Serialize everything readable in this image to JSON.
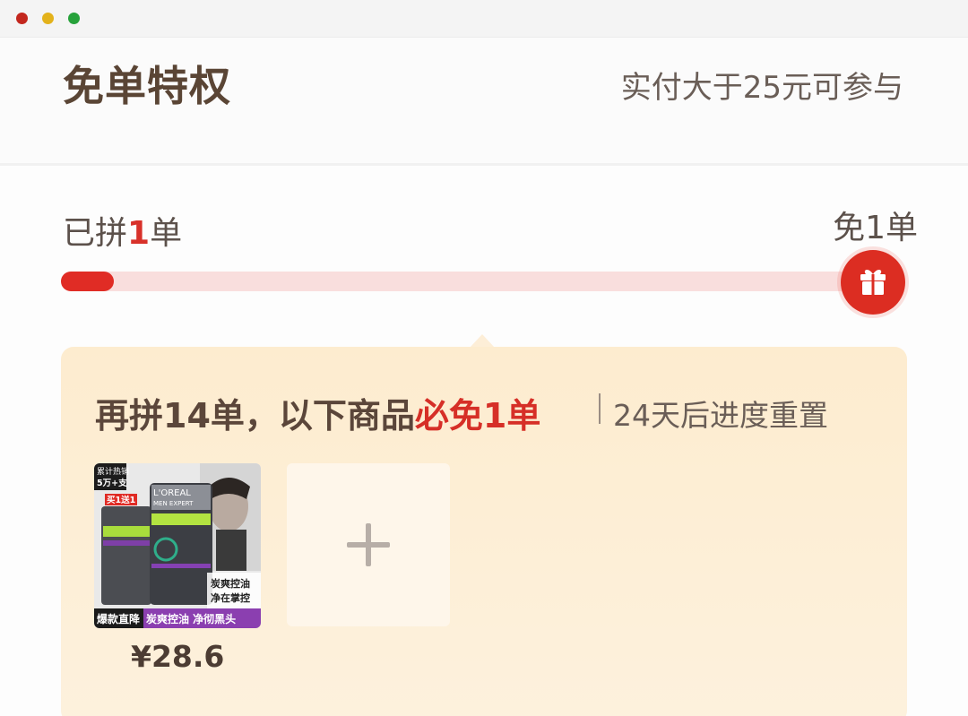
{
  "header": {
    "title": "免单特权",
    "requirement": "实付大于25元可参与"
  },
  "progress": {
    "done_prefix": "已拼",
    "done_count": "1",
    "done_suffix": "单",
    "goal_label": "免1单",
    "fraction": 0.0667,
    "icon": "gift-icon",
    "colors": {
      "fill": "#e02c25",
      "track": "#f9dedd",
      "accent": "#dc2d22"
    }
  },
  "offer": {
    "headline_prefix": "再拼14单，以下商品",
    "headline_highlight": "必免1单",
    "reset_note": "24天后进度重置",
    "products": [
      {
        "badge_top": "累计热销",
        "badge_count": "5万+支",
        "promo_tag": "买1送1",
        "brand": "L'OREAL",
        "line": "MEN EXPERT",
        "side_text_1": "炭爽控油",
        "side_text_2": "净在掌控",
        "bottom_left": "爆款直降",
        "bottom_right": "炭爽控油 净彻黑头",
        "price": "¥28.6"
      }
    ],
    "add_icon": "plus-icon"
  }
}
